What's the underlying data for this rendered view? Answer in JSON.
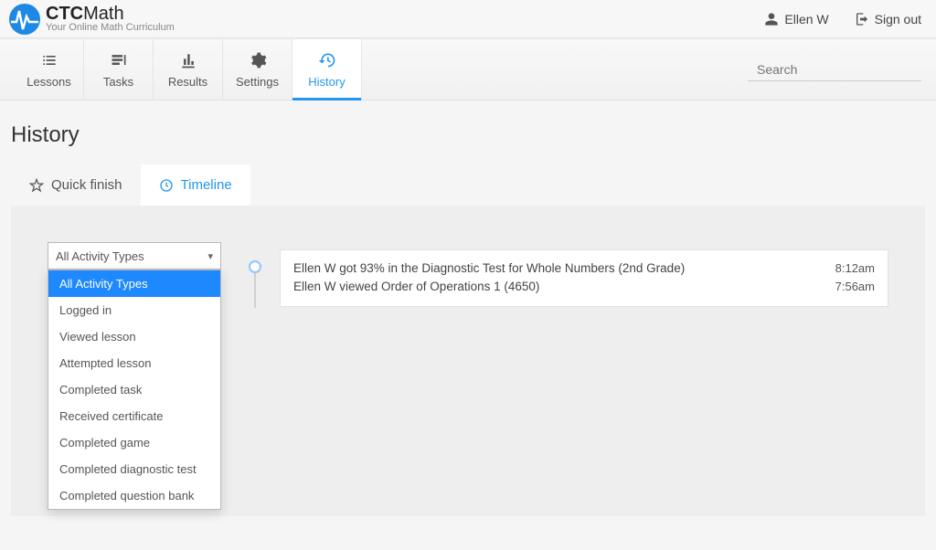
{
  "brand": {
    "name_bold": "CTC",
    "name_thin": "Math",
    "tagline": "Your Online Math Curriculum"
  },
  "top": {
    "user": "Ellen W",
    "signout": "Sign out"
  },
  "nav": {
    "lessons": "Lessons",
    "tasks": "Tasks",
    "results": "Results",
    "settings": "Settings",
    "history": "History",
    "search_placeholder": "Search"
  },
  "page": {
    "title": "History"
  },
  "tabs": {
    "quick": "Quick finish",
    "timeline": "Timeline"
  },
  "filter": {
    "selected": "All Activity Types",
    "options": [
      "All Activity Types",
      "Logged in",
      "Viewed lesson",
      "Attempted lesson",
      "Completed task",
      "Received certificate",
      "Completed game",
      "Completed diagnostic test",
      "Completed question bank"
    ]
  },
  "events": [
    {
      "text": "Ellen W got 93% in the Diagnostic Test for Whole Numbers (2nd Grade)",
      "time": "8:12am"
    },
    {
      "text": "Ellen W viewed Order of Operations 1 (4650)",
      "time": "7:56am"
    }
  ]
}
